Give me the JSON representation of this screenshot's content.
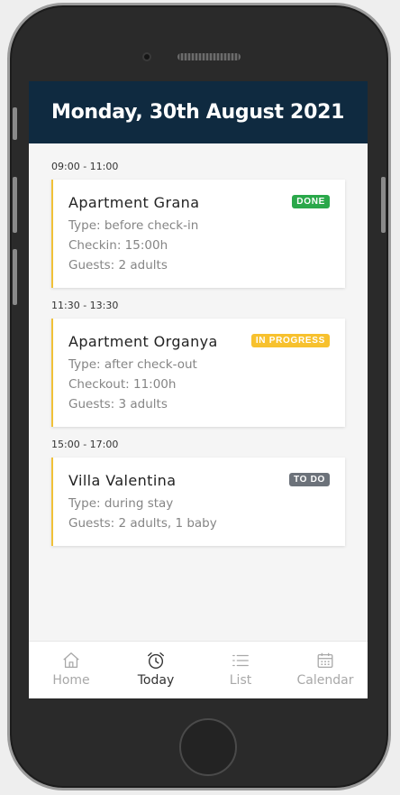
{
  "header": {
    "title": "Monday, 30th August 2021"
  },
  "colors": {
    "header_bg": "#0f2a40",
    "accent": "#f0c138",
    "done": "#2aa84a",
    "in_progress": "#f7c12e",
    "todo": "#6c727a"
  },
  "slots": [
    {
      "time": "09:00 - 11:00",
      "title": "Apartment Grana",
      "status": "DONE",
      "lines": [
        "Type: before check-in",
        "Checkin: 15:00h",
        "Guests: 2 adults"
      ]
    },
    {
      "time": "11:30 - 13:30",
      "title": "Apartment Organya",
      "status": "IN PROGRESS",
      "lines": [
        "Type: after check-out",
        "Checkout: 11:00h",
        "Guests: 3 adults"
      ]
    },
    {
      "time": "15:00 - 17:00",
      "title": "Villa Valentina",
      "status": "TO DO",
      "lines": [
        "Type: during stay",
        "Guests: 2 adults, 1 baby"
      ]
    }
  ],
  "tabs": [
    {
      "label": "Home",
      "icon": "home-icon",
      "active": false
    },
    {
      "label": "Today",
      "icon": "alarm-clock-icon",
      "active": true
    },
    {
      "label": "List",
      "icon": "list-icon",
      "active": false
    },
    {
      "label": "Calendar",
      "icon": "calendar-icon",
      "active": false
    }
  ]
}
